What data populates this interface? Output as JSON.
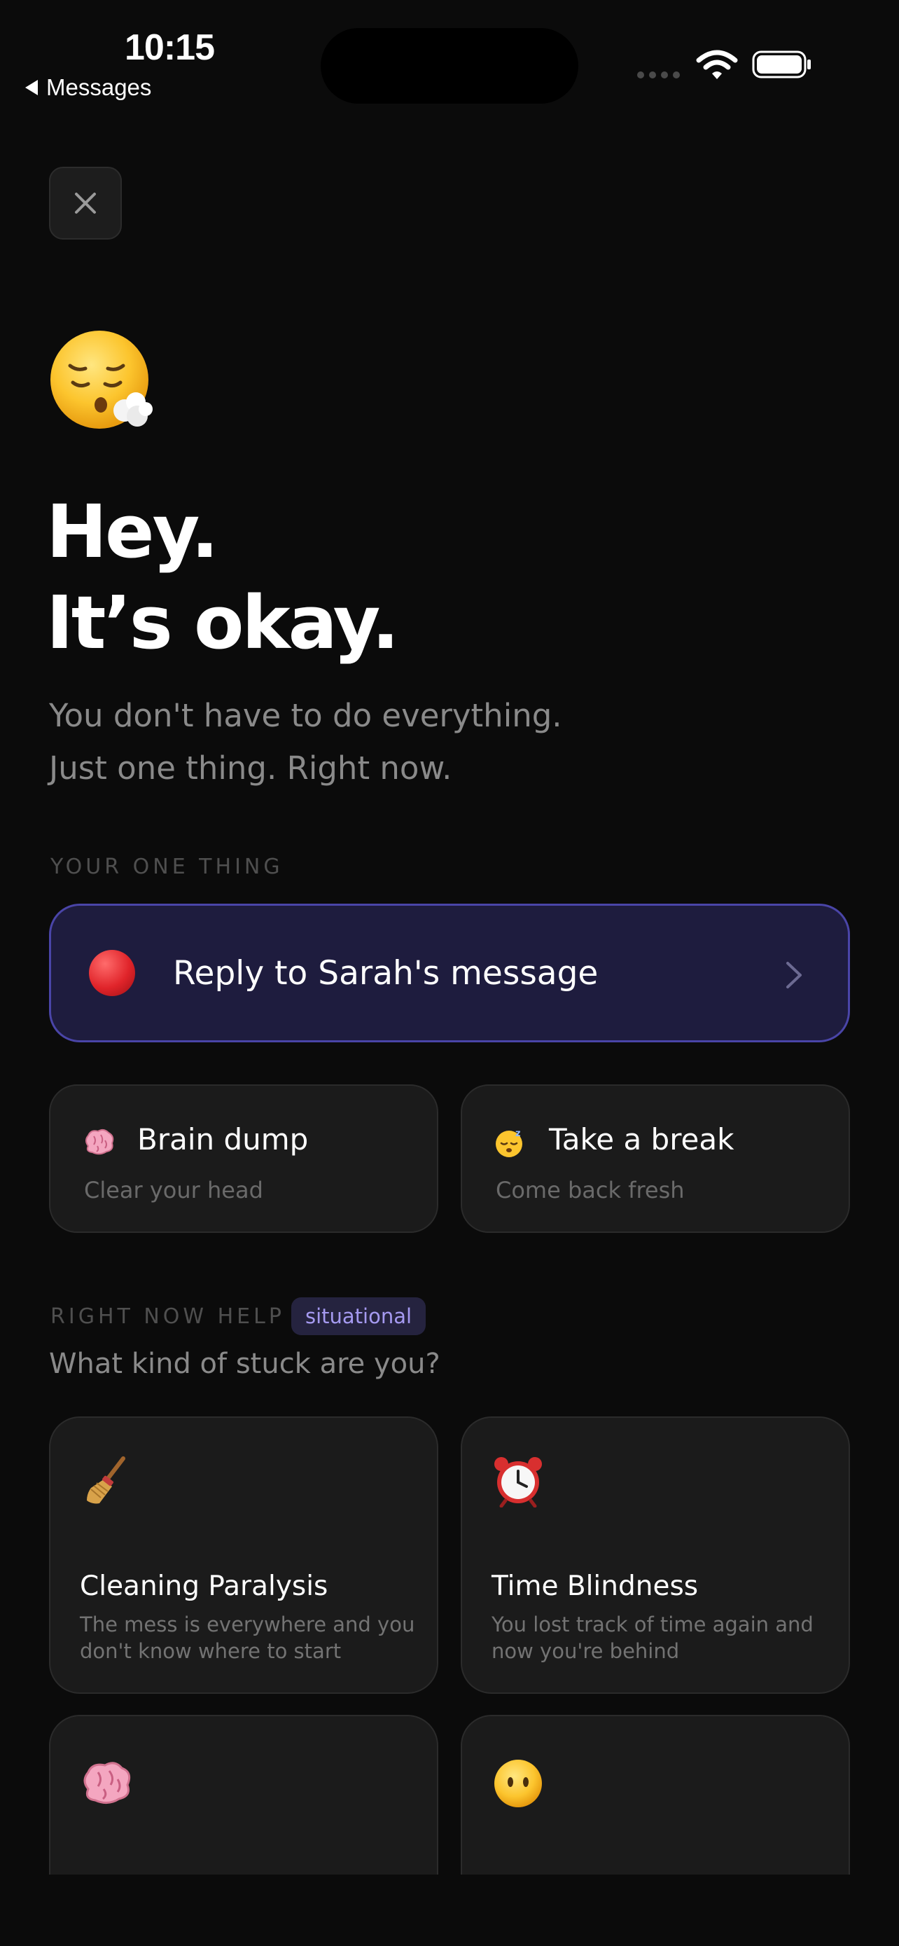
{
  "status_bar": {
    "time": "10:15",
    "back_label": "Messages"
  },
  "close_button": {
    "icon": "close-icon"
  },
  "hero": {
    "emoji": "😮‍💨",
    "headline_line1": "Hey.",
    "headline_line2": "It’s okay.",
    "subtitle_line1": "You don't have to do everything.",
    "subtitle_line2": "Just one thing. Right now."
  },
  "one_thing": {
    "section_label": "YOUR ONE THING",
    "task_icon": "red-circle-icon",
    "task_label": "Reply to Sarah's message",
    "chevron_icon": "chevron-right-icon"
  },
  "quick_actions": [
    {
      "icon": "brain-icon",
      "title": "Brain dump",
      "subtitle": "Clear your head"
    },
    {
      "icon": "sleeping-face-icon",
      "title": "Take a break",
      "subtitle": "Come back fresh"
    }
  ],
  "right_now_help": {
    "section_label": "RIGHT NOW HELP",
    "badge": "situational",
    "question": "What kind of stuck are you?",
    "cards": [
      {
        "icon": "broom-icon",
        "title": "Cleaning Paralysis",
        "description": "The mess is everywhere and you don't know where to start"
      },
      {
        "icon": "alarm-clock-icon",
        "title": "Time Blindness",
        "description": "You lost track of time again and now you're behind"
      },
      {
        "icon": "brain-icon",
        "title": "",
        "description": ""
      },
      {
        "icon": "face-without-mouth-icon",
        "title": "",
        "description": ""
      }
    ]
  },
  "colors": {
    "background": "#0b0b0b",
    "accent_card": "#1e1c3e",
    "accent_border": "#4a45a8",
    "badge_text": "#a59af0"
  }
}
